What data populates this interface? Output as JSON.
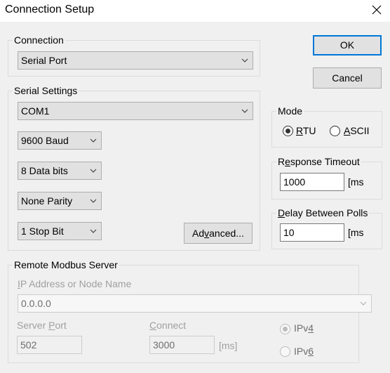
{
  "window": {
    "title": "Connection Setup",
    "close_icon": "close-x-icon"
  },
  "connection": {
    "legend": "Connection",
    "selected": "Serial Port"
  },
  "buttons": {
    "ok": "OK",
    "cancel": "Cancel",
    "advanced_pre": "Ad",
    "advanced_u": "v",
    "advanced_post": "anced..."
  },
  "serial": {
    "legend": "Serial Settings",
    "port": "COM1",
    "baud": "9600 Baud",
    "data_bits": "8 Data bits",
    "parity": "None Parity",
    "stop_bits": "1 Stop Bit"
  },
  "mode": {
    "legend": "Mode",
    "options": [
      {
        "u": "R",
        "rest": "TU",
        "checked": true
      },
      {
        "u": "A",
        "rest": "SCII",
        "checked": false
      }
    ]
  },
  "response_timeout": {
    "legend_pre": "R",
    "legend_u": "e",
    "legend_post": "sponse Timeout",
    "value": "1000",
    "unit": "[ms"
  },
  "delay_polls": {
    "legend_u": "D",
    "legend_post": "elay Between Polls",
    "value": "10",
    "unit": "[ms"
  },
  "remote": {
    "legend": "Remote Modbus Server",
    "ip_label_u": "I",
    "ip_label_post": "P Address or Node Name",
    "ip_value": "0.0.0.0",
    "port_label_pre": "Server ",
    "port_label_u": "P",
    "port_label_post": "ort",
    "port_value": "502",
    "connect_label_u": "C",
    "connect_label_post": "onnect",
    "connect_value": "3000",
    "connect_unit": "[ms]",
    "ip_versions": [
      {
        "pre": "IPv",
        "u": "4",
        "checked": true
      },
      {
        "pre": "IPv",
        "u": "6",
        "checked": false
      }
    ]
  }
}
